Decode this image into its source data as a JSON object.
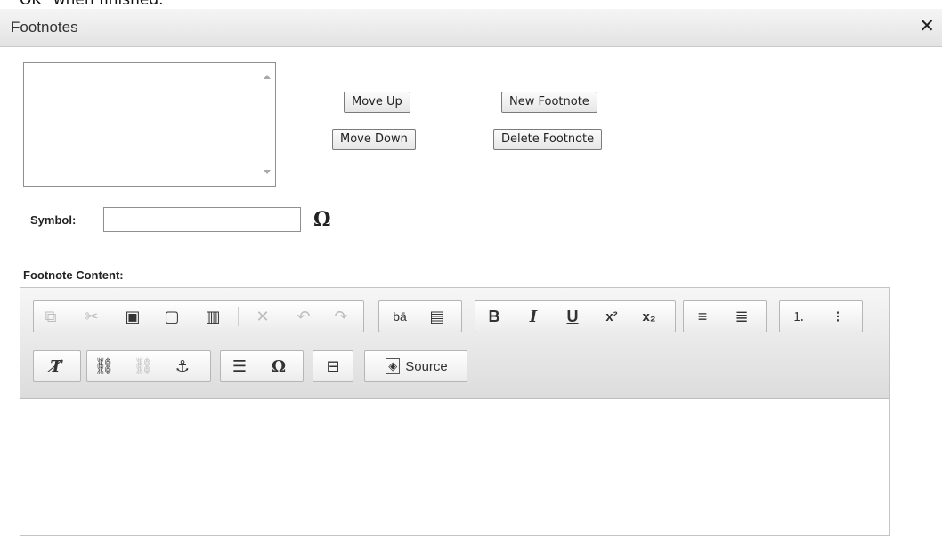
{
  "cut_text": "OK\" when finished.",
  "dialog": {
    "title": "Footnotes",
    "close_glyph": "✕"
  },
  "footnote_list": {
    "items": []
  },
  "buttons": {
    "move_up": "Move Up",
    "move_down": "Move Down",
    "new_footnote": "New Footnote",
    "delete_footnote": "Delete Footnote"
  },
  "symbol": {
    "label": "Symbol:",
    "value": "",
    "char_glyph": "Ω"
  },
  "content_label": "Footnote Content:",
  "toolbar": {
    "row1": [
      {
        "name": "copy-icon",
        "glyph": "⧉",
        "disabled": true
      },
      {
        "name": "cut-icon",
        "glyph": "✂",
        "disabled": true
      },
      {
        "name": "paste-icon",
        "glyph": "📋",
        "disabled": false
      },
      {
        "name": "paste-text-icon",
        "glyph": "T",
        "disabled": false
      },
      {
        "name": "paste-word-icon",
        "glyph": "W",
        "disabled": false
      },
      {
        "name": "remove-format-disabled-icon",
        "glyph": "✕",
        "disabled": true
      },
      {
        "name": "undo-icon",
        "glyph": "↶",
        "disabled": true
      },
      {
        "name": "redo-icon",
        "glyph": "↷",
        "disabled": true
      },
      {
        "name": "find-replace-icon",
        "glyph": "bā",
        "disabled": false
      },
      {
        "name": "select-all-icon",
        "glyph": "▤",
        "disabled": false
      },
      {
        "name": "bold-icon",
        "glyph": "B",
        "disabled": false
      },
      {
        "name": "italic-icon",
        "glyph": "I",
        "disabled": false
      },
      {
        "name": "underline-icon",
        "glyph": "U",
        "disabled": false
      },
      {
        "name": "superscript-icon",
        "glyph": "x²",
        "disabled": false
      },
      {
        "name": "subscript-icon",
        "glyph": "x₂",
        "disabled": false
      },
      {
        "name": "align-left-icon",
        "glyph": "≡",
        "disabled": false
      },
      {
        "name": "justify-icon",
        "glyph": "≣",
        "disabled": false
      },
      {
        "name": "numbered-list-icon",
        "glyph": "⒈",
        "disabled": false
      },
      {
        "name": "bulleted-list-icon",
        "glyph": "⁝",
        "disabled": false
      }
    ],
    "source_label": "Source"
  }
}
